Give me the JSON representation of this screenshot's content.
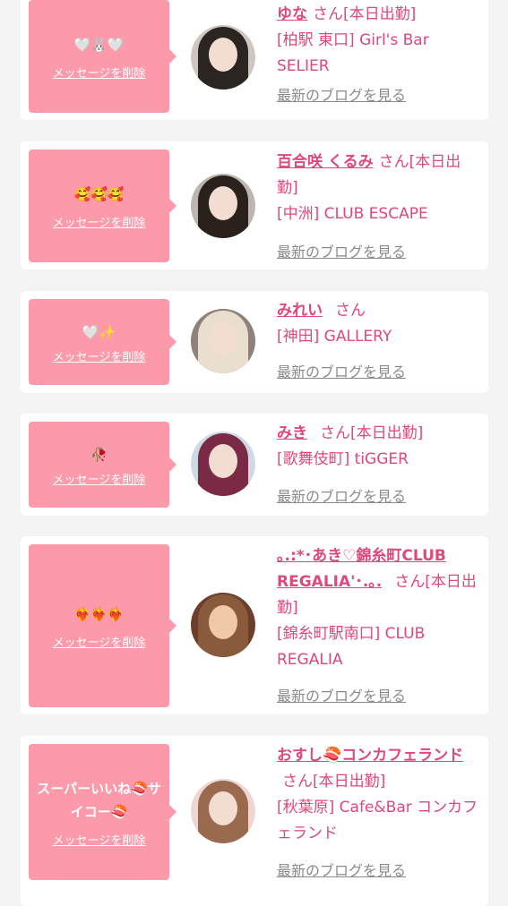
{
  "delete_label": "メッセージを削除",
  "blog_label": "最新のブログを見る",
  "colors": {
    "accent": "#e0477a",
    "bubble": "#fc9aab",
    "muted": "#8a8a8a"
  },
  "cards": [
    {
      "message": "🤍🐰🤍",
      "name": "ゆな",
      "san": "さん[本日出勤]",
      "shop": "[柏駅 東口] Girl's Bar SELIER"
    },
    {
      "message": "🥰🥰🥰",
      "name": "百合咲 くるみ",
      "san": "さん[本日出勤]",
      "shop": "[中洲] CLUB ESCAPE"
    },
    {
      "message": "🤍✨",
      "name": "みれい",
      "san": "さん",
      "shop": "[神田] GALLERY"
    },
    {
      "message": "🥀",
      "name": "みき",
      "san": "さん[本日出勤]",
      "shop": "[歌舞伎町] tiGGER"
    },
    {
      "message": "❤️‍🔥❤️‍🔥❤️‍🔥",
      "name": "｡.:*･あき♡錦糸町CLUB REGALIA'･.｡.",
      "san": "さん[本日出勤]",
      "shop": "[錦糸町駅南口] CLUB REGALIA"
    },
    {
      "message": "スーパーいいね🍣サイコー🍣",
      "name": "おすし🍣コンカフェランド",
      "san": "さん[本日出勤]",
      "shop": "[秋葉原] Cafe&Bar コンカフェランド"
    }
  ]
}
